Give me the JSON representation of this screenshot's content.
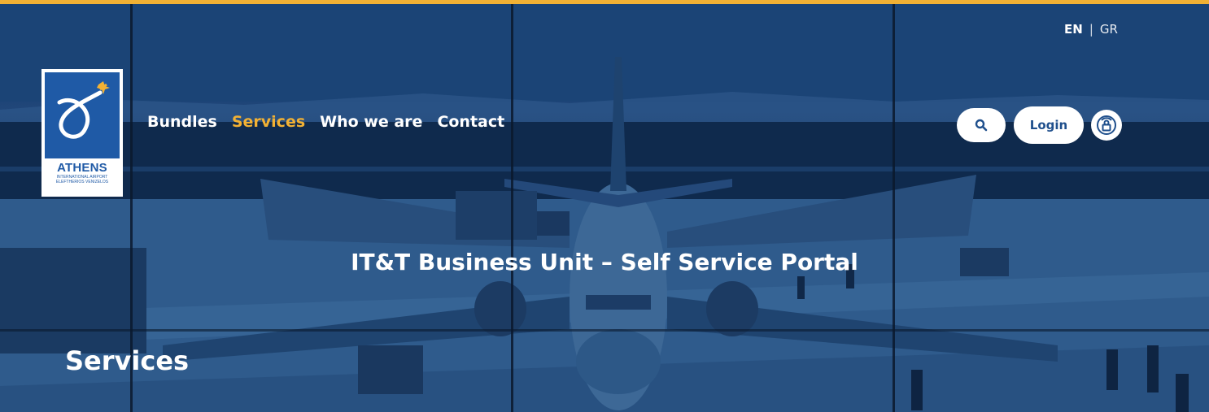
{
  "colors": {
    "accent": "#f2b134",
    "brand_blue": "#1f5aa6",
    "overlay": "#1c4479",
    "text": "#ffffff"
  },
  "logo": {
    "name": "ATHENS",
    "subtitle_line1": "INTERNATIONAL AIRPORT",
    "subtitle_line2": "ELEFTHERIOS VENIZELOS",
    "icon": "airport-logo-icon"
  },
  "nav": {
    "items": [
      {
        "label": "Bundles",
        "active": false
      },
      {
        "label": "Services",
        "active": true
      },
      {
        "label": "Who we are",
        "active": false
      },
      {
        "label": "Contact",
        "active": false
      }
    ]
  },
  "language": {
    "current": "EN",
    "separator": "|",
    "other": "GR"
  },
  "header_actions": {
    "search_icon": "search-icon",
    "login_label": "Login",
    "accessibility_icon": "accessibility-icon"
  },
  "hero": {
    "portal_title": "IT&T Business Unit – Self Service Portal",
    "page_title": "Services"
  }
}
